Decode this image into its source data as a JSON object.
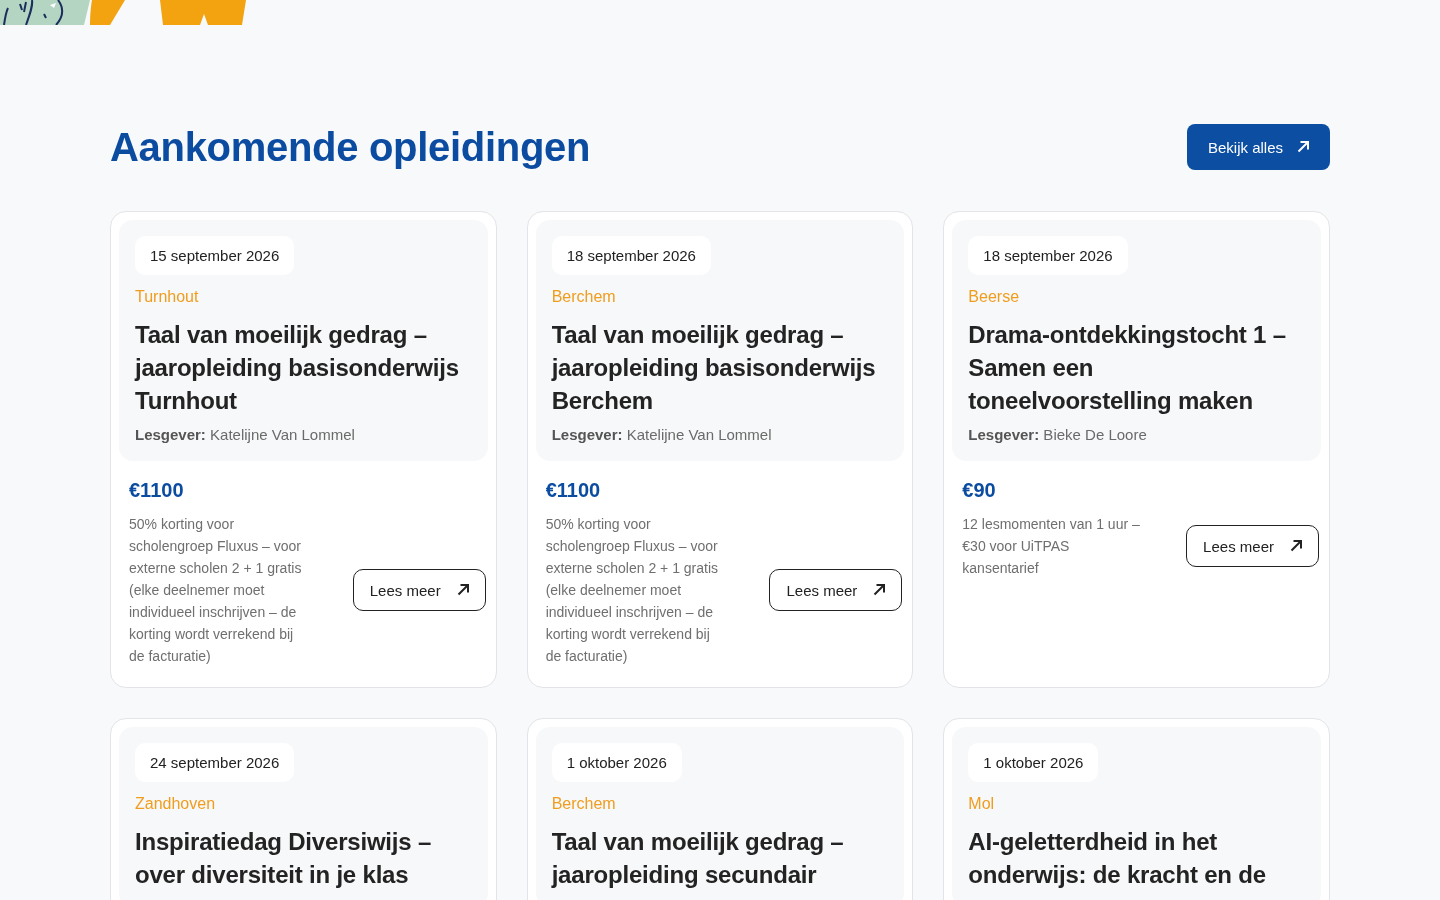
{
  "section": {
    "title": "Aankomende opleidingen",
    "view_all": {
      "label": "Bekijk alles"
    }
  },
  "courses": [
    {
      "date": "15 september 2026",
      "location": "Turnhout",
      "title": "Taal van moeilijk gedrag – jaaropleiding basisonderwijs Turnhout",
      "teacher": "**Lesgever:** Katelijne Van Lommel",
      "price": "€1100",
      "note": "50% korting voor scholengroep Fluxus – voor externe scholen 2 + 1 gratis (elke deelnemer moet individueel inschrijven – de korting wordt verrekend bij de facturatie)",
      "button": "Lees meer"
    },
    {
      "date": "18 september 2026",
      "location": "Berchem",
      "title": "Taal van moeilijk gedrag – jaaropleiding basisonderwijs Berchem",
      "teacher": "**Lesgever:** Katelijne Van Lommel",
      "price": "€1100",
      "note": "50% korting voor scholengroep Fluxus – voor externe scholen 2 + 1 gratis (elke deelnemer moet individueel inschrijven – de korting wordt verrekend bij de facturatie)",
      "button": "Lees meer"
    },
    {
      "date": "18 september 2026",
      "location": "Beerse",
      "title": "Drama-ontdekkingstocht 1 – Samen een toneelvoorstelling maken",
      "teacher": "**Lesgever:** Bieke De Loore",
      "price": "€90",
      "note": "12 lesmomenten van 1 uur – €30 voor UiTPAS kansentarief",
      "button": "Lees meer"
    },
    {
      "date": "24 september 2026",
      "location": "Zandhoven",
      "title": "Inspiratiedag Diversiwijs – over diversiteit in je klas"
    },
    {
      "date": "1 oktober 2026",
      "location": "Berchem",
      "title": "Taal van moeilijk gedrag – jaaropleiding secundair"
    },
    {
      "date": "1 oktober 2026",
      "location": "Mol",
      "title": "AI-geletterdheid in het onderwijs: de kracht en de"
    }
  ]
}
